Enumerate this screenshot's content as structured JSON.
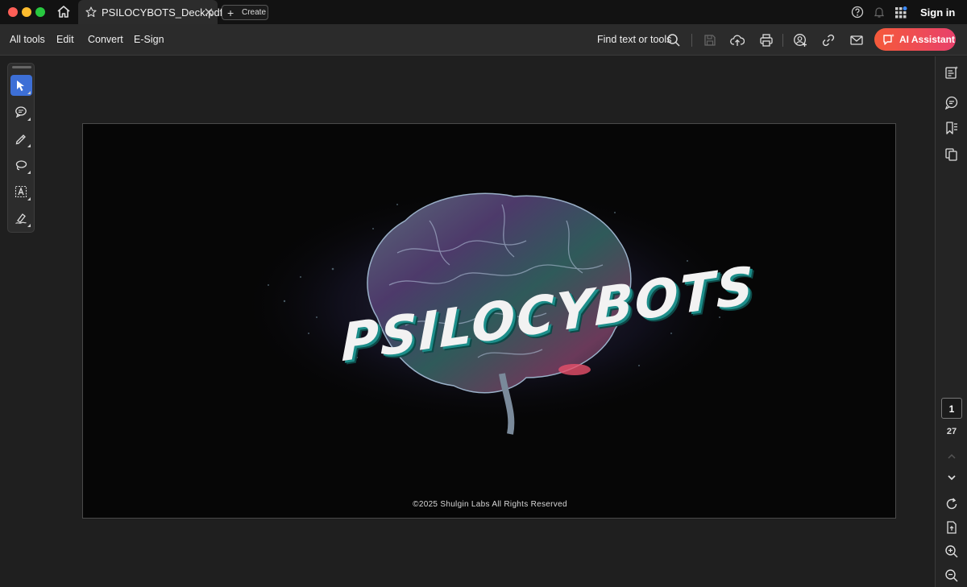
{
  "titlebar": {
    "tab_title": "PSILOCYBOTS_Deck.pdf",
    "create_label": "Create",
    "sign_in_label": "Sign in",
    "icons": [
      "home-icon",
      "star-icon",
      "close-icon",
      "help-icon",
      "bell-icon",
      "apps-grid-icon"
    ]
  },
  "toolbar": {
    "menu": [
      "All tools",
      "Edit",
      "Convert",
      "E-Sign"
    ],
    "find_label": "Find text or tools",
    "ai_label": "AI Assistant",
    "icons": [
      "search-icon",
      "save-icon",
      "upload-icon",
      "print-icon",
      "share-user-icon",
      "link-icon",
      "mail-icon"
    ]
  },
  "left_tools": [
    "select-icon",
    "comment-icon",
    "pen-icon",
    "lasso-icon",
    "text-select-icon",
    "sign-icon"
  ],
  "document": {
    "logo_text": "PSILOCYBOTS",
    "copyright": "©2025 Shulgin Labs All Rights Reserved"
  },
  "right_bar": {
    "current_page": "1",
    "total_pages": "27",
    "icons": [
      "properties-icon",
      "comment-panel-icon",
      "bookmark-icon",
      "pages-icon",
      "chevron-up-icon",
      "chevron-down-icon",
      "rotate-icon",
      "export-icon",
      "zoom-in-icon",
      "zoom-out-icon"
    ]
  },
  "colors": {
    "accent": "#3d6fd6",
    "ai_gradient_start": "#f55a3a",
    "ai_gradient_end": "#e8406b",
    "logo_shadow": "#1d8e8a"
  }
}
